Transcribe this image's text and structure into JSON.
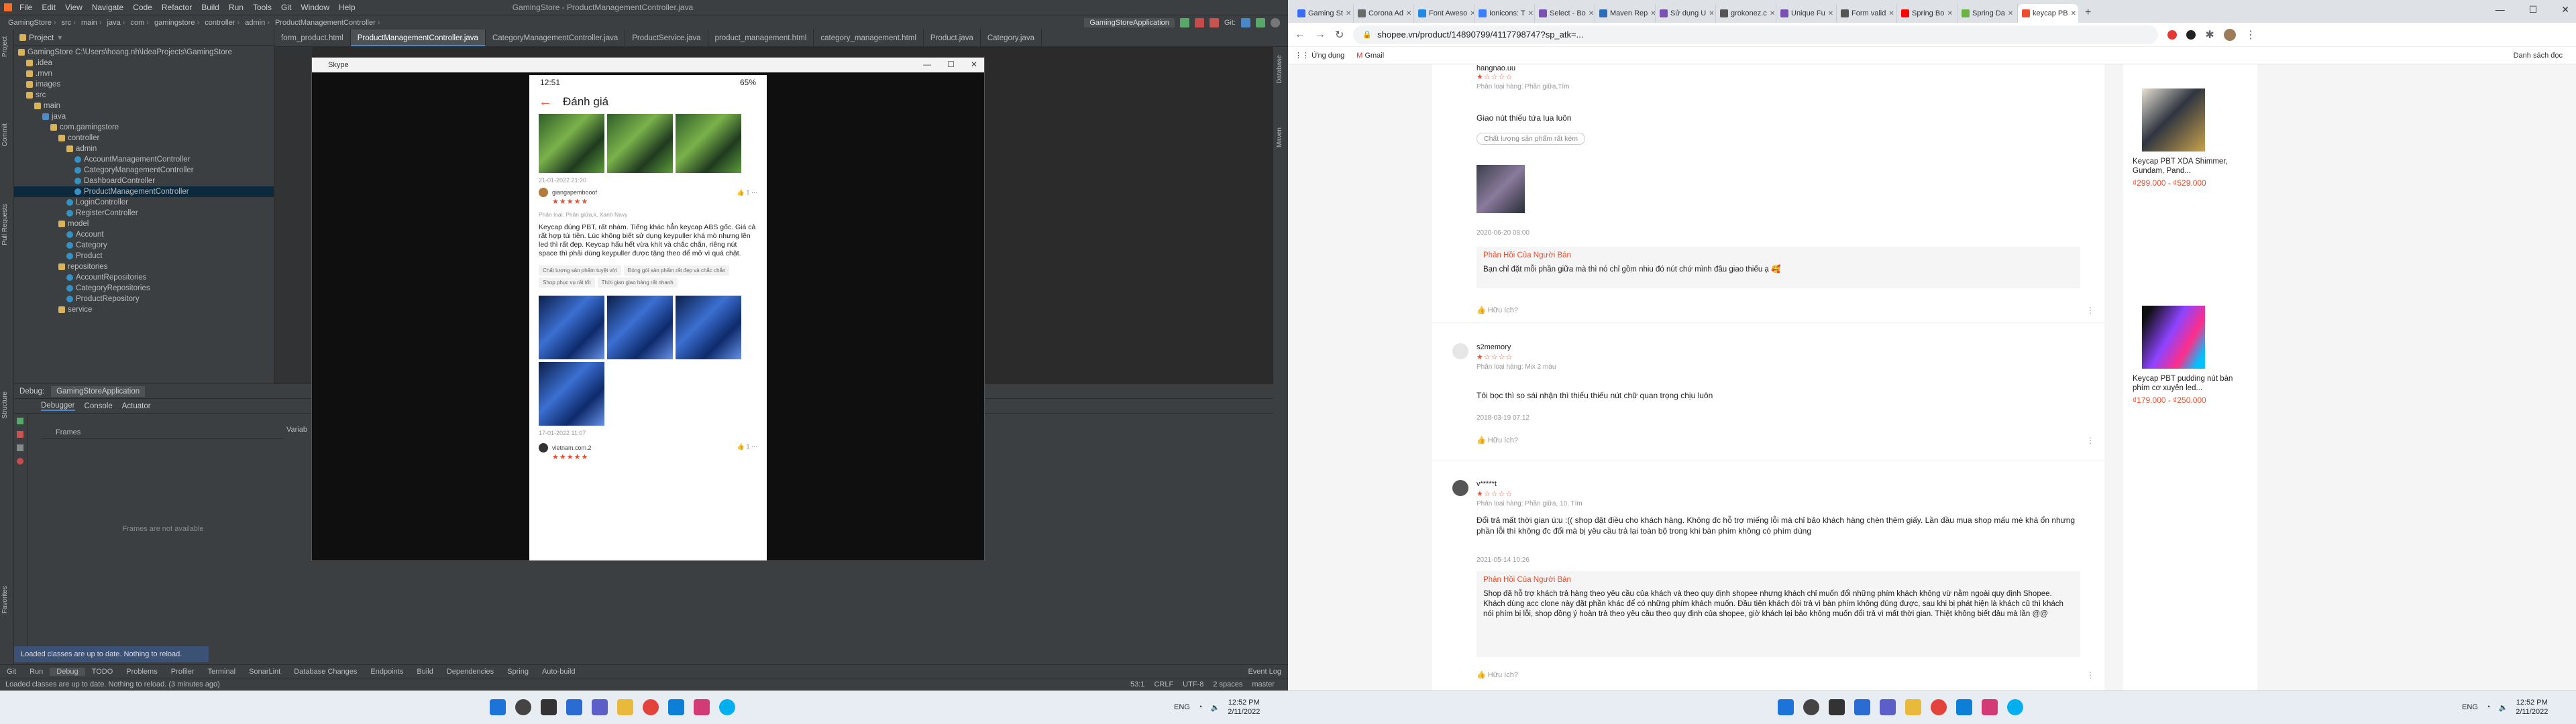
{
  "ide": {
    "menu": [
      "File",
      "Edit",
      "View",
      "Navigate",
      "Code",
      "Refactor",
      "Build",
      "Run",
      "Tools",
      "Git",
      "Window",
      "Help"
    ],
    "window_title": "GamingStore - ProductManagementController.java",
    "breadcrumbs": [
      "GamingStore",
      "src",
      "main",
      "java",
      "com",
      "gamingstore",
      "controller",
      "admin",
      "ProductManagementController"
    ],
    "run_config": "GamingStoreApplication",
    "git_label": "Git:",
    "project_title": "Project",
    "project_tree": [
      {
        "label": "GamingStore  C:\\Users\\hoang.nh\\IdeaProjects\\GamingStore",
        "indent": 0,
        "icon": "folder"
      },
      {
        "label": ".idea",
        "indent": 1,
        "icon": "folder"
      },
      {
        "label": ".mvn",
        "indent": 1,
        "icon": "folder"
      },
      {
        "label": "images",
        "indent": 1,
        "icon": "folder"
      },
      {
        "label": "src",
        "indent": 1,
        "icon": "folder"
      },
      {
        "label": "main",
        "indent": 2,
        "icon": "folder"
      },
      {
        "label": "java",
        "indent": 3,
        "icon": "src"
      },
      {
        "label": "com.gamingstore",
        "indent": 4,
        "icon": "folder"
      },
      {
        "label": "controller",
        "indent": 5,
        "icon": "folder"
      },
      {
        "label": "admin",
        "indent": 6,
        "icon": "folder"
      },
      {
        "label": "AccountManagementController",
        "indent": 7,
        "icon": "class"
      },
      {
        "label": "CategoryManagementController",
        "indent": 7,
        "icon": "class"
      },
      {
        "label": "DashboardController",
        "indent": 7,
        "icon": "class"
      },
      {
        "label": "ProductManagementController",
        "indent": 7,
        "icon": "class",
        "selected": true
      },
      {
        "label": "LoginController",
        "indent": 6,
        "icon": "class"
      },
      {
        "label": "RegisterController",
        "indent": 6,
        "icon": "class"
      },
      {
        "label": "model",
        "indent": 5,
        "icon": "folder"
      },
      {
        "label": "Account",
        "indent": 6,
        "icon": "class"
      },
      {
        "label": "Category",
        "indent": 6,
        "icon": "class"
      },
      {
        "label": "Product",
        "indent": 6,
        "icon": "class"
      },
      {
        "label": "repositories",
        "indent": 5,
        "icon": "folder"
      },
      {
        "label": "AccountRepositories",
        "indent": 6,
        "icon": "class"
      },
      {
        "label": "CategoryRepositories",
        "indent": 6,
        "icon": "class"
      },
      {
        "label": "ProductRepository",
        "indent": 6,
        "icon": "class"
      },
      {
        "label": "service",
        "indent": 5,
        "icon": "folder"
      }
    ],
    "editor_tabs": [
      "form_product.html",
      "ProductManagementController.java",
      "CategoryManagementController.java",
      "ProductService.java",
      "product_management.html",
      "category_management.html",
      "Product.java",
      "Category.java"
    ],
    "active_tab": 1,
    "debug_title": "Debug:",
    "debug_config": "GamingStoreApplication",
    "debug_tabs": [
      "Debugger",
      "Console",
      "Actuator"
    ],
    "frames_label": "Frames",
    "frames_empty": "Frames are not available",
    "variables_label": "Variab",
    "notification": "Loaded classes are up to date. Nothing to reload.",
    "bottom_tools": [
      "Git",
      "Run",
      "Debug",
      "TODO",
      "Problems",
      "Profiler",
      "Terminal",
      "SonarLint",
      "Database Changes",
      "Endpoints",
      "Build",
      "Dependencies",
      "Spring",
      "Auto-build"
    ],
    "active_bottom_tool": 2,
    "event_log": "Event Log",
    "status_left": "Loaded classes are up to date. Nothing to reload. (3 minutes ago)",
    "status_right": [
      "53:1",
      "CRLF",
      "UTF-8",
      "2 spaces",
      "master"
    ]
  },
  "skype": {
    "title": "Skype",
    "phone": {
      "time": "12:51",
      "battery": "65%",
      "header": "Đánh giá",
      "first_date": "21-01-2022 21:20",
      "review": {
        "user": "giangapembooof",
        "stars": "★★★★★",
        "likes": "1",
        "variant": "Phân loại: Phân giữa,k, Xanh Navy",
        "text": "Keycap đúng PBT, rất nhám. Tiếng khác hẳn keycap ABS gốc. Giá cả rất hợp túi tiền. Lúc không biết sử dụng keypuller khá mò nhưng lên led thì rất đẹp. Keycap hấu hết vừa khít và chắc chắn, riêng nút space thì phải dùng keypuller được tặng theo để mở vì quá chặt.",
        "tags": [
          "Chất lượng sản phẩm tuyệt vời",
          "Đóng gói sản phẩm rất đẹp và chắc chắn",
          "Shop phục vụ rất tốt",
          "Thời gian giao hàng rất nhanh"
        ],
        "date": "17-01-2022 11:07"
      },
      "next_user": "vietnam.com.2",
      "next_likes": "1",
      "next_stars": "★★★★★"
    }
  },
  "browser": {
    "tabs": [
      {
        "title": "Gaming St",
        "color": "#3c6df0"
      },
      {
        "title": "Corona Ad",
        "color": "#6b6b6b"
      },
      {
        "title": "Font Aweso",
        "color": "#228ae6"
      },
      {
        "title": "Ionicons: T",
        "color": "#3880ff"
      },
      {
        "title": "Select - Bo",
        "color": "#7952b3"
      },
      {
        "title": "Maven Rep",
        "color": "#2d6db5"
      },
      {
        "title": "Sử dụng U",
        "color": "#7952b3"
      },
      {
        "title": "grokonez.c",
        "color": "#555555"
      },
      {
        "title": "Unique Fu",
        "color": "#7952b3"
      },
      {
        "title": "Form valid",
        "color": "#555555"
      },
      {
        "title": "Spring Bo",
        "color": "#ff0000"
      },
      {
        "title": "Spring Da",
        "color": "#6db33f"
      },
      {
        "title": "keycap PB",
        "color": "#ee4d2d",
        "active": true
      }
    ],
    "url": "shopee.vn/product/14890799/4117798747?sp_atk=...",
    "bookmarks": [
      "Ứng dụng",
      "Gmail"
    ],
    "reading_list": "Danh sách đọc",
    "reviews": [
      {
        "name": "hangnao.uu",
        "stars": "★☆☆☆☆",
        "variant": "Phân loại hàng: Phần giữa,Tím",
        "body": "Giao nút thiếu tứa lua luôn",
        "tag": "Chất lượng sản phẩm rất kém",
        "date": "2020-06-20 08:00",
        "reply_title": "Phản Hồi Của Người Bán",
        "reply": "Bạn chỉ đặt mỗi phần giữa mà thì nó chỉ gồm nhiu đó nút chứ mình đâu giao thiếu ạ 🥰",
        "helpful": "Hữu ích?"
      },
      {
        "name": "s2memory",
        "stars": "★☆☆☆☆",
        "variant": "Phân loại hàng: Mix 2 màu",
        "body": "Tôi bọc thì so sái nhận thì thiếu thiếu nút chữ quan trọng chịu luôn",
        "date": "2018-03-19 07:12",
        "helpful": "Hữu ích?"
      },
      {
        "name": "v*****t",
        "stars": "★☆☆☆☆",
        "variant": "Phân loại hàng: Phần giữa, 10, Tím",
        "body": "Đổi trả mất thời gian ú:u :(( shop đặt điều cho khách hàng. Không đc hỗ trợ miếng lỗi mà chỉ bảo khách hàng chèn thêm giấy. Lần đầu mua shop mấu mè khá ổn nhưng phần lỗi thì không đc đổi mà bị yêu cầu trả lại toàn bộ trong khi bàn phím không có phím dùng",
        "date": "2021-05-14 10:26",
        "reply_title": "Phản Hồi Của Người Bán",
        "reply": "Shop đã hỗ trợ khách trả hàng theo yêu cầu của khách và theo quy định shopee nhưng khách chỉ muốn đổi những phím khách không vừ nằm ngoài quy định Shopee. Khách dùng acc clone này đặt phần khác để có những phím khách muốn. Đầu tiên khách đòi trả vì bàn phím không đúng được, sau khi bị phát hiện là khách cũ thì khách nói phím bị lỗi, shop đồng ý hoàn trả theo yêu cầu theo quy định của shopee, giờ khách lại bảo không muốn đổi trả vì mất thời gian. Thiệt không biết đâu mà lần @@",
        "helpful": "Hữu ích?"
      }
    ],
    "products": [
      {
        "name": "Keycap PBT XDA Shimmer, Gundam, Pand...",
        "price": "₫299.000 - ₫529.000",
        "colors": [
          "#2f3540",
          "#e7e1d4",
          "#c9a24b"
        ]
      },
      {
        "name": "Keycap PBT pudding nút bàn phím cơ xuyên led...",
        "price": "₫179.000 - ₫250.000",
        "colors": [
          "#0e0e10",
          "#8e44ff",
          "#ff2d8a"
        ]
      }
    ]
  },
  "taskbar": {
    "time": "12:52 PM",
    "date": "2/11/2022",
    "lang": "ENG"
  }
}
